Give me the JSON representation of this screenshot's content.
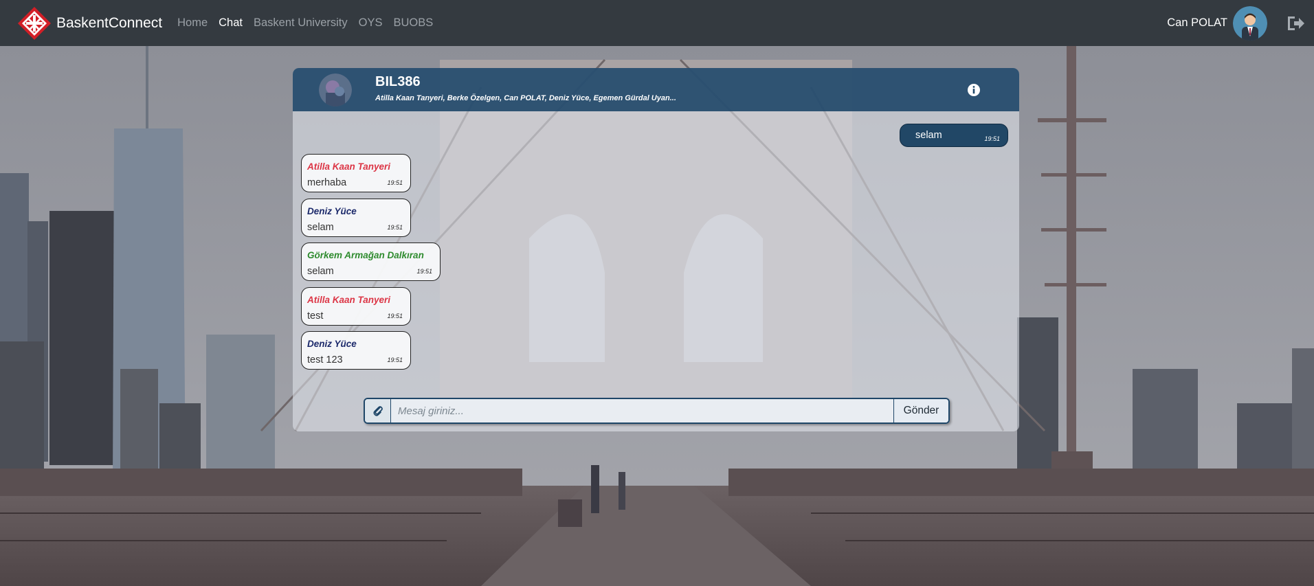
{
  "navbar": {
    "brand": "BaskentConnect",
    "links": [
      {
        "label": "Home",
        "active": false
      },
      {
        "label": "Chat",
        "active": true
      },
      {
        "label": "Baskent University",
        "active": false
      },
      {
        "label": "OYS",
        "active": false
      },
      {
        "label": "BUOBS",
        "active": false
      }
    ],
    "user_name": "Can POLAT",
    "icons": [
      "brand-logo-icon",
      "user-avatar",
      "logout-icon"
    ]
  },
  "chat": {
    "group_name": "BIL386",
    "members": "Atilla Kaan Tanyeri, Berke Özelgen, Can POLAT, Deniz Yüce, Egemen Gürdal Uyan...",
    "own_message": {
      "text": "selam",
      "time": "19:51"
    },
    "messages": [
      {
        "sender": "Atilla Kaan Tanyeri",
        "text": "merhaba",
        "time": "19:51",
        "color": "#dc3545"
      },
      {
        "sender": "Deniz Yüce",
        "text": "selam",
        "time": "19:51",
        "color": "#1c2a6b"
      },
      {
        "sender": "Görkem Armağan Dalkıran",
        "text": "selam",
        "time": "19:51",
        "color": "#2e8b2e"
      },
      {
        "sender": "Atilla Kaan Tanyeri",
        "text": "test",
        "time": "19:51",
        "color": "#dc3545"
      },
      {
        "sender": "Deniz Yüce",
        "text": "test 123",
        "time": "19:51",
        "color": "#1c2a6b"
      }
    ],
    "input_placeholder": "Mesaj giriniz...",
    "send_label": "Gönder"
  },
  "colors": {
    "navbar_bg": "#343a40",
    "header_bg": "#1e4668",
    "own_bubble": "#214766"
  }
}
